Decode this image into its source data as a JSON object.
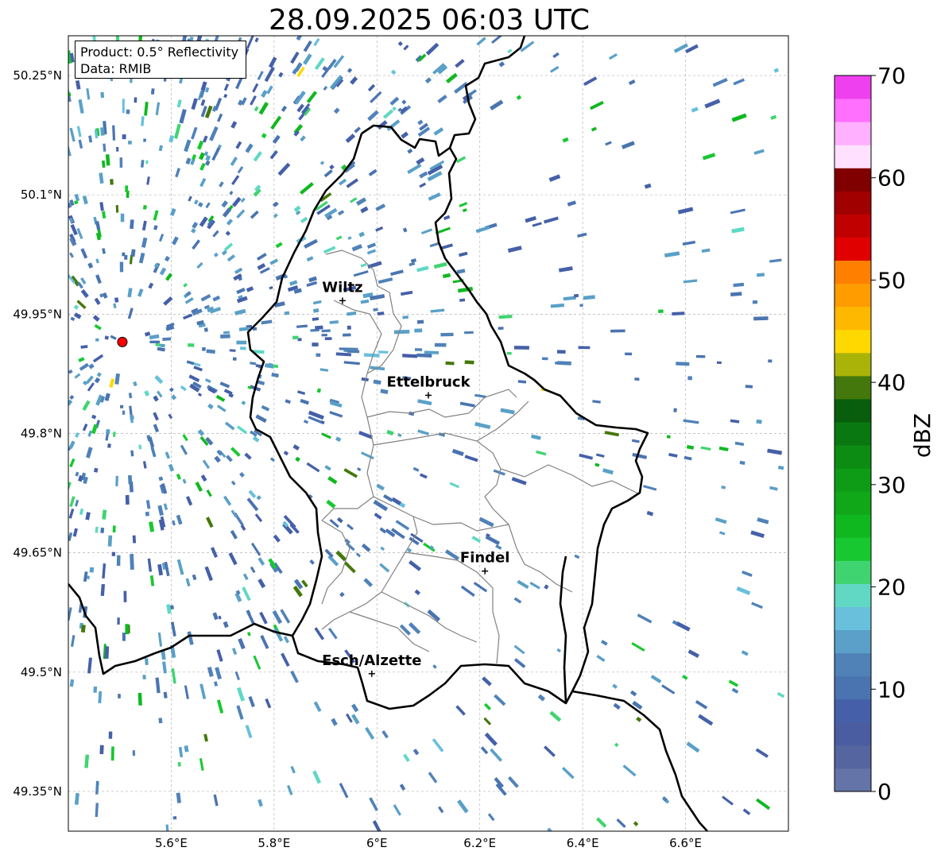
{
  "title": "28.09.2025 06:03 UTC",
  "info": {
    "product": "Product: 0.5° Reflectivity",
    "source": "Data: RMIB"
  },
  "map": {
    "lon_range": [
      5.4,
      6.8
    ],
    "lat_range": [
      49.3,
      50.3
    ],
    "lat_ticks": [
      {
        "value": 49.35,
        "label": "49.35°N"
      },
      {
        "value": 49.5,
        "label": "49.5°N"
      },
      {
        "value": 49.65,
        "label": "49.65°N"
      },
      {
        "value": 49.8,
        "label": "49.8°N"
      },
      {
        "value": 49.95,
        "label": "49.95°N"
      },
      {
        "value": 50.1,
        "label": "50.1°N"
      },
      {
        "value": 50.25,
        "label": "50.25°N"
      }
    ],
    "lon_ticks": [
      {
        "value": 5.6,
        "label": "5.6°E"
      },
      {
        "value": 5.8,
        "label": "5.8°E"
      },
      {
        "value": 6.0,
        "label": "6°E"
      },
      {
        "value": 6.2,
        "label": "6.2°E"
      },
      {
        "value": 6.4,
        "label": "6.4°E"
      },
      {
        "value": 6.6,
        "label": "6.6°E"
      }
    ],
    "grid": true,
    "radar_site": {
      "lon": 5.505,
      "lat": 49.915,
      "color": "#ff0000"
    },
    "cities": [
      {
        "name": "Wiltz",
        "lon": 5.933,
        "lat": 49.967
      },
      {
        "name": "Ettelbruck",
        "lon": 6.1,
        "lat": 49.848
      },
      {
        "name": "Findel",
        "lon": 6.21,
        "lat": 49.627
      },
      {
        "name": "Esch/Alzette",
        "lon": 5.99,
        "lat": 49.498
      }
    ]
  },
  "colorbar": {
    "label": "dBZ",
    "min": 0,
    "max": 70,
    "ticks": [
      {
        "value": 0,
        "label": "0"
      },
      {
        "value": 10,
        "label": "10"
      },
      {
        "value": 20,
        "label": "20"
      },
      {
        "value": 30,
        "label": "30"
      },
      {
        "value": 40,
        "label": "40"
      },
      {
        "value": 50,
        "label": "50"
      },
      {
        "value": 60,
        "label": "60"
      },
      {
        "value": 70,
        "label": "70"
      }
    ],
    "colors": [
      "#6474a8",
      "#5565a0",
      "#4a5da0",
      "#4560a8",
      "#4a74b0",
      "#5082b8",
      "#5aa0c8",
      "#68c0dc",
      "#60d8c4",
      "#40d470",
      "#18c830",
      "#10b820",
      "#10a818",
      "#0e9c16",
      "#0c8c12",
      "#0a7810",
      "#085e0c",
      "#44780c",
      "#aab408",
      "#ffd800",
      "#ffb800",
      "#ff9c00",
      "#ff8000",
      "#e00000",
      "#c00000",
      "#a00000",
      "#800000",
      "#ffe0ff",
      "#ffb0ff",
      "#ff70ff",
      "#ee40ee"
    ]
  }
}
